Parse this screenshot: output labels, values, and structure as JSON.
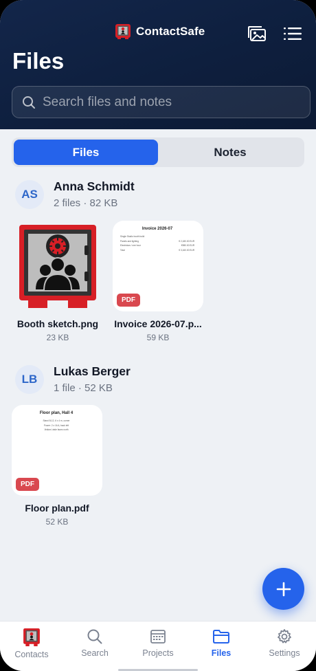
{
  "app": {
    "name": "ContactSafe",
    "page_title": "Files"
  },
  "search": {
    "placeholder": "Search files and notes"
  },
  "tabs": {
    "files": "Files",
    "notes": "Notes",
    "active": "files"
  },
  "groups": [
    {
      "initials": "AS",
      "name": "Anna Schmidt",
      "meta": "2 files · 82 KB",
      "files": [
        {
          "name": "Booth sketch.png",
          "size": "23 KB",
          "kind": "image"
        },
        {
          "name": "Invoice 2026-07.p...",
          "size": "59 KB",
          "kind": "pdf",
          "badge": "PDF",
          "preview_title": "Invoice 2026-07",
          "preview_rows": [
            [
              "Single Studio booth build",
              ""
            ],
            [
              "Panels and lighting",
              "€ 2,180.00 EUR"
            ],
            [
              "Electrician / one hour",
              "€980.00 EUR"
            ],
            [
              "Total",
              "€ 3,160.00 EUR"
            ]
          ]
        }
      ]
    },
    {
      "initials": "LB",
      "name": "Lukas Berger",
      "meta": "1 file · 52 KB",
      "files": [
        {
          "name": "Floor plan.pdf",
          "size": "52 KB",
          "kind": "pdf",
          "badge": "PDF",
          "preview_title": "Floor plan, Hall 4",
          "preview_lines": [
            "Stand B-12, 6 x 4 m, corner",
            "Power: 2 x 16 A, back left",
            "Visitors' aisle faces north"
          ]
        }
      ]
    }
  ],
  "nav": {
    "contacts": "Contacts",
    "search": "Search",
    "projects": "Projects",
    "files": "Files",
    "settings": "Settings",
    "active": "files"
  },
  "colors": {
    "accent": "#2563eb",
    "header": "#13264a",
    "logo_red": "#d71f26",
    "pdf_badge": "#d9484f"
  },
  "icons": {
    "brand": "contactsafe-logo-icon",
    "gallery": "image-gallery-icon",
    "menu": "list-menu-icon",
    "search": "search-icon",
    "add": "plus-icon"
  }
}
